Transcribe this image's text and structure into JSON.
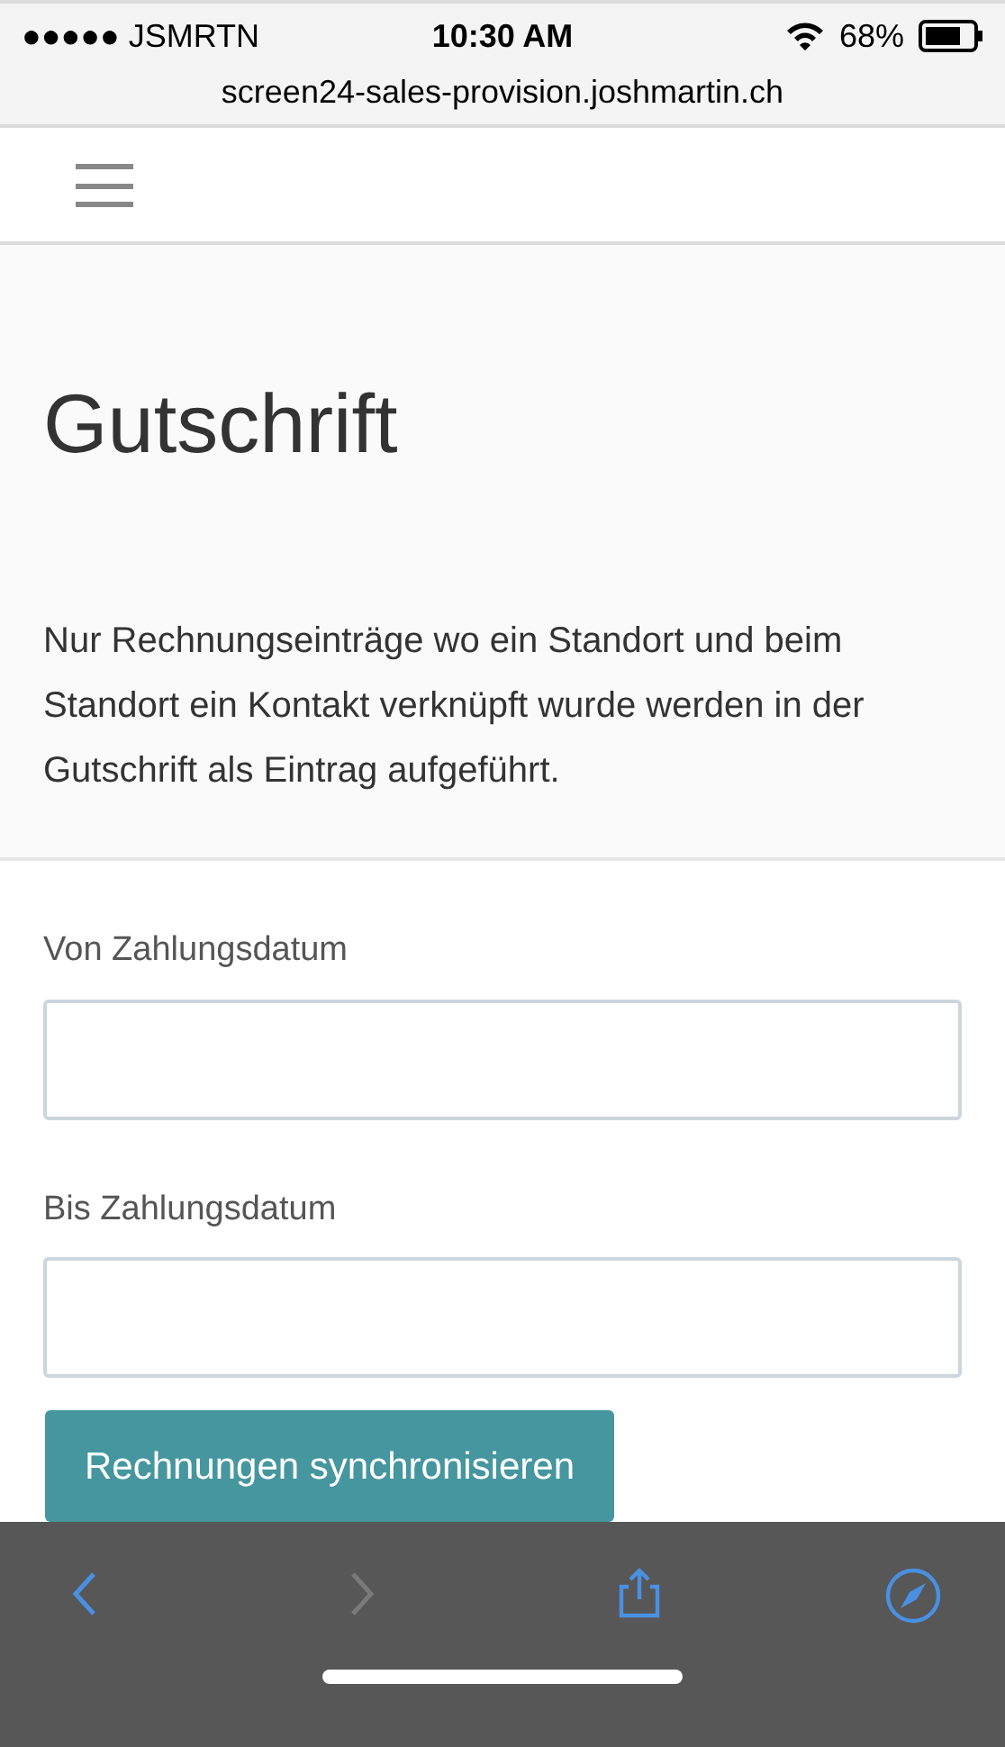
{
  "status_bar": {
    "carrier": "●●●●● JSMRTN",
    "time": "10:30 AM",
    "battery": "68%",
    "url": "screen24-sales-provision.joshmartin.ch"
  },
  "header": {
    "title": "Gutschrift",
    "description": "Nur Rechnungseinträge wo ein Standort und beim Standort ein Kontakt verknüpft wurde werden in der Gutschrift als Eintrag aufgeführt."
  },
  "form": {
    "fields": [
      {
        "label": "Von Zahlungsdatum"
      },
      {
        "label": "Bis Zahlungsdatum"
      }
    ],
    "button": "Rechnungen synchronisieren"
  },
  "toolbar": [
    {
      "kind": "back",
      "disabled": false
    },
    {
      "kind": "forward",
      "disabled": true
    },
    {
      "kind": "share",
      "disabled": false
    },
    {
      "kind": "compass",
      "disabled": false
    }
  ]
}
